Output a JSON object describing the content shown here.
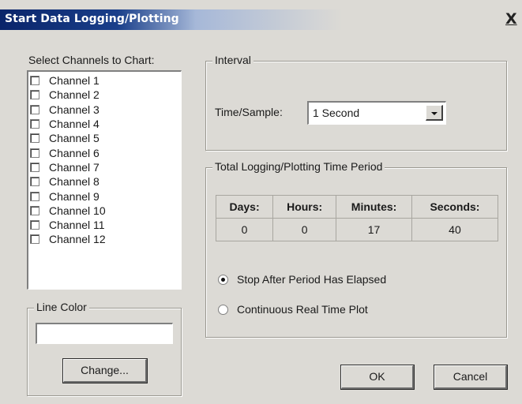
{
  "window": {
    "title": "Start Data Logging/Plotting",
    "close": "X"
  },
  "channels": {
    "label": "Select Channels to Chart:",
    "items": [
      "Channel 1",
      "Channel 2",
      "Channel 3",
      "Channel 4",
      "Channel 5",
      "Channel 6",
      "Channel 7",
      "Channel 8",
      "Channel 9",
      "Channel 10",
      "Channel 11",
      "Channel 12"
    ]
  },
  "line_color": {
    "title": "Line Color",
    "value": "",
    "change_label": "Change..."
  },
  "interval": {
    "title": "Interval",
    "time_label": "Time/Sample:",
    "time_value": "1 Second"
  },
  "period": {
    "title": "Total Logging/Plotting Time Period",
    "headers": [
      "Days:",
      "Hours:",
      "Minutes:",
      "Seconds:"
    ],
    "values": [
      "0",
      "0",
      "17",
      "40"
    ]
  },
  "mode": {
    "options": [
      "Stop After Period Has Elapsed",
      "Continuous Real Time Plot"
    ],
    "selected": 0
  },
  "buttons": {
    "ok": "OK",
    "cancel": "Cancel"
  }
}
